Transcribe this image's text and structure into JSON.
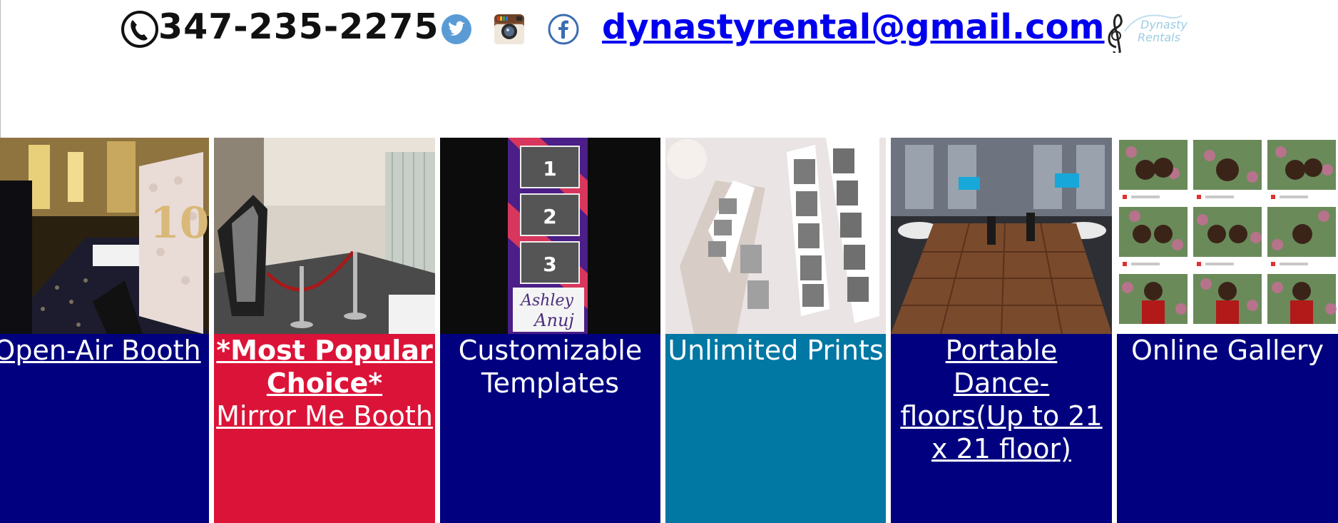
{
  "header": {
    "phone_number": "347-235-2275",
    "email": "dynastyrental@gmail.com",
    "logo_text_line1": "Dynasty",
    "logo_text_line2": "Rentals",
    "social": [
      "twitter-icon",
      "instagram-icon",
      "facebook-icon"
    ]
  },
  "colors": {
    "navy": "#01017f",
    "crimson": "#dc1338",
    "teal": "#0177a3",
    "twitter": "#5b9bd5",
    "facebook": "#3b6db3",
    "link": "#0000ee"
  },
  "tiles": [
    {
      "caption": "Open-Air Booth",
      "bg": "#01017f"
    },
    {
      "caption_highlight": "*Most Popular Choice*",
      "caption": "Mirror Me Booth",
      "bg": "#dc1338"
    },
    {
      "caption": "Customizable Templates",
      "bg": "#01017f",
      "template_numbers": [
        "1",
        "2",
        "3"
      ],
      "template_names": "Ashley",
      "template_names_2": "Anuj"
    },
    {
      "caption": "Unlimited Prints",
      "bg": "#0177a3"
    },
    {
      "caption": "Portable Dance-floors(Up to 21 x 21 floor)",
      "bg": "#01017f"
    },
    {
      "caption": "Online Gallery",
      "bg": "#01017f"
    }
  ]
}
